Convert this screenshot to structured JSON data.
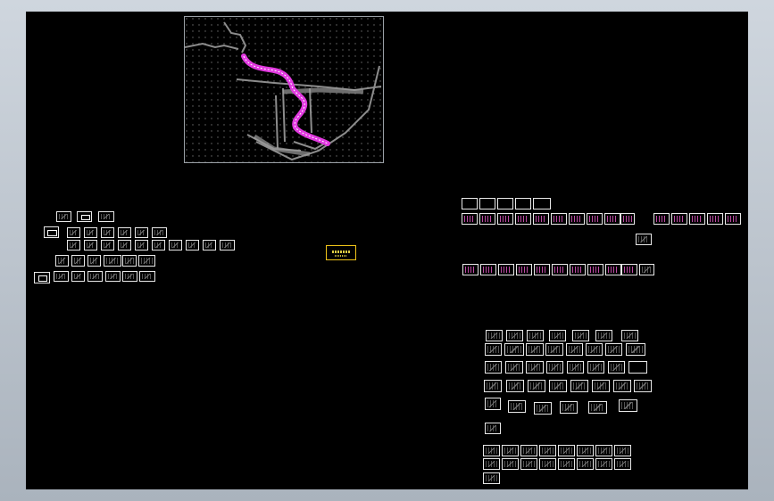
{
  "canvas": {
    "background": "#000000",
    "border": "#ffffff"
  },
  "map": {
    "frame_color": "#9aa0a6",
    "route_color": "#e23ae0",
    "road_color": "#8c8c8c",
    "grid_dot_color": "#6e6e6e"
  },
  "stamp": {
    "label": "",
    "color": "#f0c419"
  },
  "accent": {
    "sheet_pink": "#ff66dd"
  }
}
